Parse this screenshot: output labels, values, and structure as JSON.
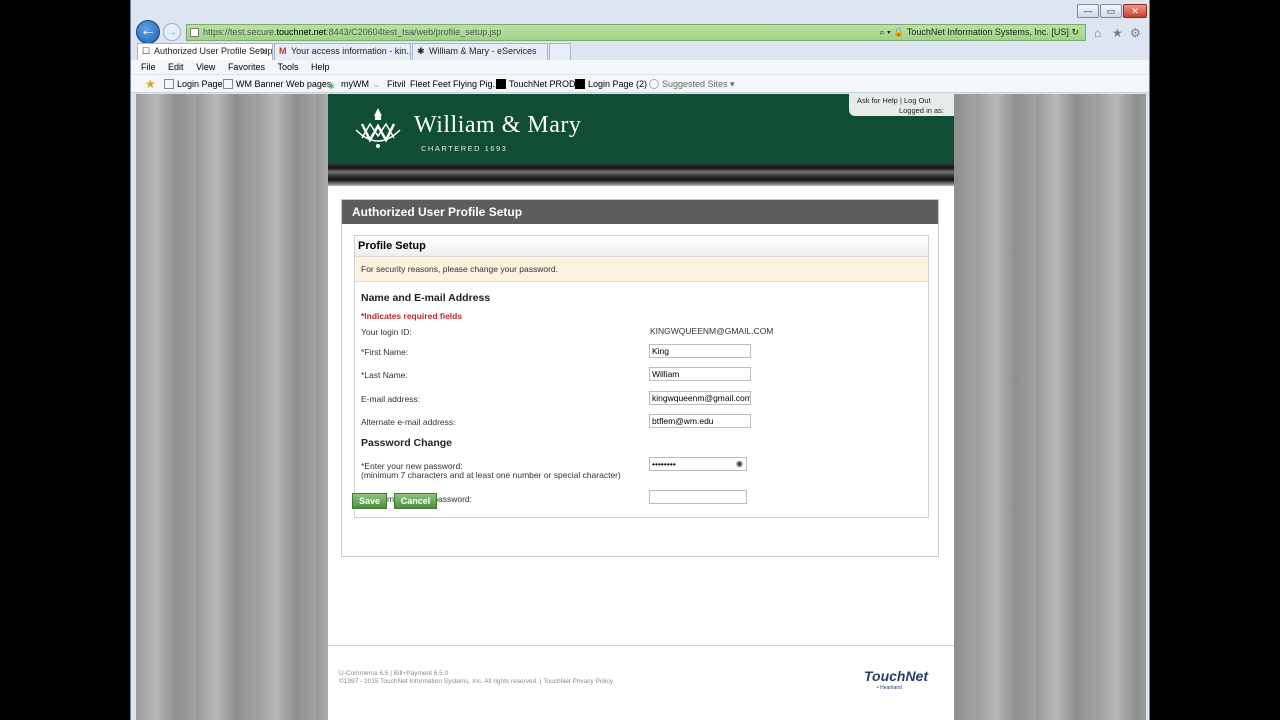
{
  "browser": {
    "url_prefix": "https://test.secure.",
    "url_host": "touchnet.net",
    "url_rest": ":8443/C20604test_tsa/web/profile_setup.jsp",
    "site_identity": "TouchNet Information Systems, Inc. [US]",
    "tabs": [
      {
        "label": "Authorized User Profile Setup",
        "close": "✕"
      },
      {
        "label": "Your access information - kin..."
      },
      {
        "label": "William & Mary - eServices"
      }
    ],
    "menu": [
      "File",
      "Edit",
      "View",
      "Favorites",
      "Tools",
      "Help"
    ],
    "favorites": [
      "Login Page",
      "WM Banner Web pages",
      "myWM",
      "Fitvil",
      "Fleet Feet Flying Pig...",
      "TouchNet PROD",
      "Login Page (2)",
      "Suggested Sites ▾"
    ]
  },
  "header": {
    "title": "William & Mary",
    "subtitle": "CHARTERED 1693",
    "help_link": "Ask for Help",
    "logout_link": "Log Out",
    "logged_in": "Logged in as:"
  },
  "panel": {
    "title": "Authorized User Profile Setup",
    "section_title": "Profile Setup",
    "notice": "For security reasons, please change your password."
  },
  "form": {
    "name_section": "Name and E-mail Address",
    "required_note": "*Indicates required fields",
    "login_label": "Your login ID:",
    "login_value": "KINGWQUEENM@GMAIL.COM",
    "first_label": "*First Name:",
    "first_value": "King",
    "last_label": "*Last Name:",
    "last_value": "William",
    "email_label": "E-mail address:",
    "email_value": "kingwqueenm@gmail.com",
    "alt_label": "Alternate e-mail address:",
    "alt_value": "btflem@wm.edu",
    "pw_section": "Password Change",
    "new_pw_label": "*Enter your new password:",
    "new_pw_hint": "(minimum 7 characters and at least one number or special character)",
    "new_pw_value": "••••••••",
    "confirm_label": "*Confirm your new password:",
    "confirm_value": "",
    "save": "Save",
    "cancel": "Cancel"
  },
  "footer": {
    "line1": "U-Commerce 6.5 | Bill+Payment 6.5.0",
    "line2": "©1997 - 2015 TouchNet Information Systems, Inc. All rights reserved. | TouchNet Privacy Policy",
    "logo": "TouchNet",
    "logo_sub": "• Heartland"
  },
  "icons": {
    "back": "←",
    "forward": "→",
    "search": "⌕",
    "refresh": "↻",
    "home": "⌂",
    "star": "★",
    "gear": "⚙",
    "eye": "👁",
    "favorites_star": "★"
  }
}
